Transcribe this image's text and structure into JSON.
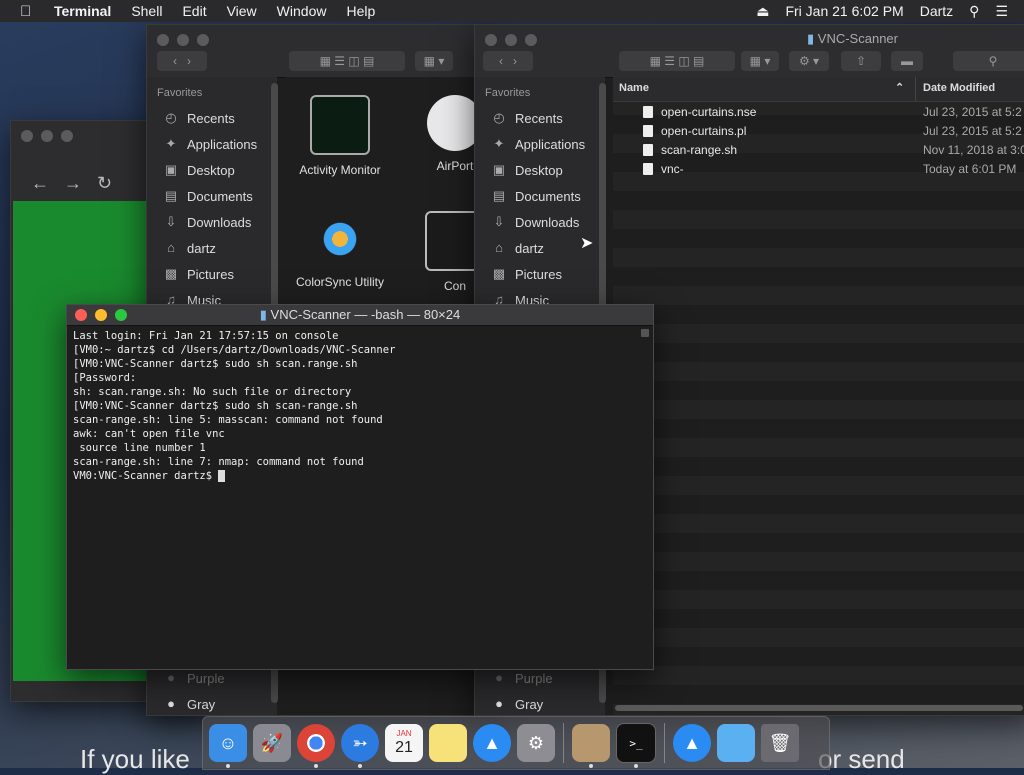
{
  "menubar": {
    "app_name": "Terminal",
    "menus": [
      "Shell",
      "Edit",
      "View",
      "Window",
      "Help"
    ],
    "datetime": "Fri Jan 21  6:02 PM",
    "user": "Dartz"
  },
  "finder_left": {
    "sidebar_header": "Favorites",
    "sidebar": [
      {
        "label": "Recents",
        "icon": "clock-icon"
      },
      {
        "label": "Applications",
        "icon": "applications-icon"
      },
      {
        "label": "Desktop",
        "icon": "desktop-icon"
      },
      {
        "label": "Documents",
        "icon": "documents-icon"
      },
      {
        "label": "Downloads",
        "icon": "downloads-icon"
      },
      {
        "label": "dartz",
        "icon": "home-icon"
      },
      {
        "label": "Pictures",
        "icon": "pictures-icon"
      },
      {
        "label": "Music",
        "icon": "music-icon"
      }
    ],
    "tag_gray": "Gray",
    "tag_purple": "Purple",
    "apps": [
      {
        "label": "Activity Monitor"
      },
      {
        "label": "AirPort"
      },
      {
        "label": "ColorSync Utility"
      },
      {
        "label": "Con"
      }
    ]
  },
  "finder_right": {
    "title": "VNC-Scanner",
    "sidebar_header": "Favorites",
    "sidebar": [
      {
        "label": "Recents",
        "icon": "clock-icon"
      },
      {
        "label": "Applications",
        "icon": "applications-icon"
      },
      {
        "label": "Desktop",
        "icon": "desktop-icon"
      },
      {
        "label": "Documents",
        "icon": "documents-icon"
      },
      {
        "label": "Downloads",
        "icon": "downloads-icon"
      },
      {
        "label": "dartz",
        "icon": "home-icon"
      },
      {
        "label": "Pictures",
        "icon": "pictures-icon"
      },
      {
        "label": "Music",
        "icon": "music-icon"
      }
    ],
    "tag_gray": "Gray",
    "tag_purple": "Purple",
    "columns": {
      "name": "Name",
      "date": "Date Modified"
    },
    "files": [
      {
        "name": "open-curtains.nse",
        "date": "Jul 23, 2015 at 5:2"
      },
      {
        "name": "open-curtains.pl",
        "date": "Jul 23, 2015 at 5:2"
      },
      {
        "name": "scan-range.sh",
        "date": "Nov 11, 2018 at 3:0"
      },
      {
        "name": "vnc-",
        "date": "Today at 6:01 PM"
      }
    ]
  },
  "terminal": {
    "title": "VNC-Scanner — -bash — 80×24",
    "lines": [
      "Last login: Fri Jan 21 17:57:15 on console",
      "[VM0:~ dartz$ cd /Users/dartz/Downloads/VNC-Scanner",
      "[VM0:VNC-Scanner dartz$ sudo sh scan.range.sh",
      "[Password:",
      "sh: scan.range.sh: No such file or directory",
      "[VM0:VNC-Scanner dartz$ sudo sh scan-range.sh",
      "scan-range.sh: line 5: masscan: command not found",
      "awk: can't open file vnc",
      " source line number 1",
      "scan-range.sh: line 7: nmap: command not found"
    ],
    "prompt": "VM0:VNC-Scanner dartz$ "
  },
  "background_text": {
    "left": "If you like",
    "right": "or send"
  },
  "dock": [
    {
      "name": "finder-icon",
      "color": "#3b8ee6",
      "running": true
    },
    {
      "name": "launchpad-icon",
      "color": "#8a8a92",
      "running": false
    },
    {
      "name": "chrome-icon",
      "color": "#e5e5e5",
      "running": true
    },
    {
      "name": "safari-icon",
      "color": "#2b7be0",
      "running": true
    },
    {
      "name": "calendar-icon",
      "color": "#f5f5f5",
      "running": false,
      "label_month": "JAN",
      "label_day": "21"
    },
    {
      "name": "notes-icon",
      "color": "#f7e27a",
      "running": false
    },
    {
      "name": "app-store-icon",
      "color": "#2a8bf2",
      "running": false
    },
    {
      "name": "system-preferences-icon",
      "color": "#8d8d93",
      "running": false
    },
    {
      "name": "preview-icon",
      "color": "#b7986e",
      "running": true
    },
    {
      "name": "terminal-icon",
      "color": "#111111",
      "running": true
    },
    {
      "name": "app-store-folder-icon",
      "color": "#2a8bf2",
      "running": false
    },
    {
      "name": "downloads-folder-icon",
      "color": "#5ab0f0",
      "running": false
    },
    {
      "name": "trash-icon",
      "color": "#6a6a70",
      "running": false
    }
  ]
}
